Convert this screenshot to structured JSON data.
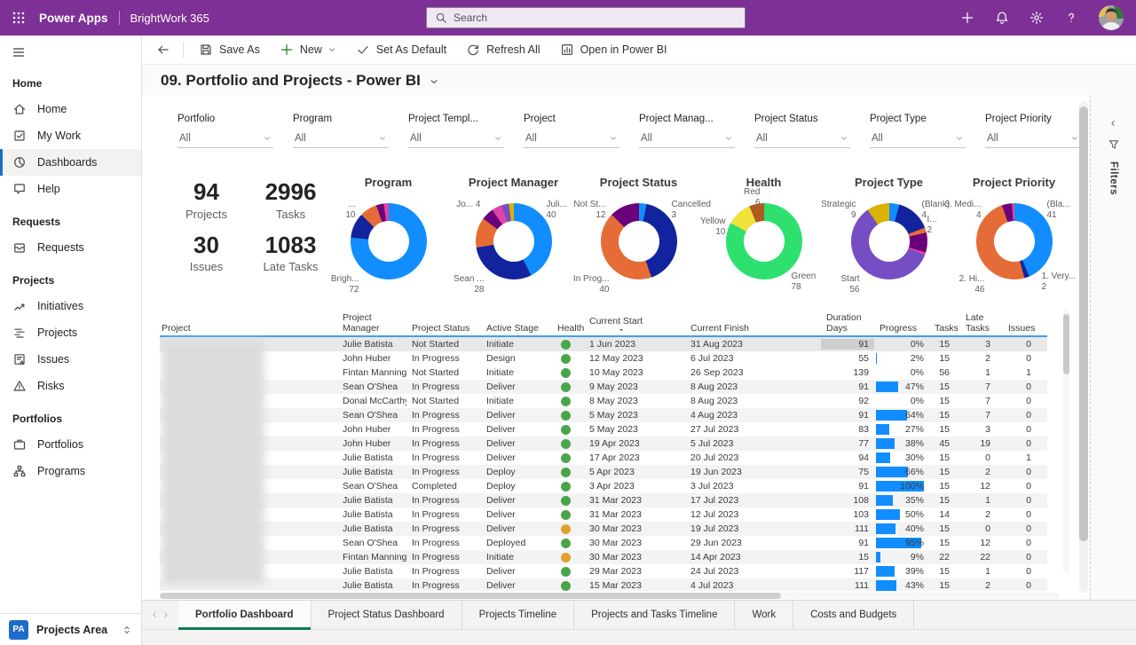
{
  "topbar": {
    "app_name": "Power Apps",
    "environment": "BrightWork 365",
    "search_placeholder": "Search"
  },
  "toolbar": {
    "commands": [
      {
        "label": "Save As",
        "icon": "save-icon"
      },
      {
        "label": "New",
        "icon": "plus-icon",
        "accent": true,
        "chevron": true
      },
      {
        "label": "Set As Default",
        "icon": "check-icon"
      },
      {
        "label": "Refresh All",
        "icon": "refresh-icon"
      },
      {
        "label": "Open in Power BI",
        "icon": "powerbi-icon"
      }
    ]
  },
  "page": {
    "title": "09. Portfolio and Projects - Power BI"
  },
  "sidebar": {
    "sections": [
      {
        "header": "Home",
        "items": [
          {
            "label": "Home",
            "icon": "home-icon",
            "active": false
          },
          {
            "label": "My Work",
            "icon": "my-work-icon",
            "active": false
          },
          {
            "label": "Dashboards",
            "icon": "dashboards-icon",
            "active": true
          },
          {
            "label": "Help",
            "icon": "help-icon",
            "active": false
          }
        ]
      },
      {
        "header": "Requests",
        "items": [
          {
            "label": "Requests",
            "icon": "requests-icon",
            "active": false
          }
        ]
      },
      {
        "header": "Projects",
        "items": [
          {
            "label": "Initiatives",
            "icon": "initiatives-icon",
            "active": false
          },
          {
            "label": "Projects",
            "icon": "projects-icon",
            "active": false
          },
          {
            "label": "Issues",
            "icon": "issues-icon",
            "active": false
          },
          {
            "label": "Risks",
            "icon": "risks-icon",
            "active": false
          }
        ]
      },
      {
        "header": "Portfolios",
        "items": [
          {
            "label": "Portfolios",
            "icon": "portfolios-icon",
            "active": false
          },
          {
            "label": "Programs",
            "icon": "programs-icon",
            "active": false
          }
        ]
      }
    ],
    "footer": {
      "initials": "PA",
      "label": "Projects Area"
    }
  },
  "filter_bar": [
    {
      "label": "Portfolio",
      "value": "All"
    },
    {
      "label": "Program",
      "value": "All"
    },
    {
      "label": "Project Templ...",
      "value": "All"
    },
    {
      "label": "Project",
      "value": "All"
    },
    {
      "label": "Project Manag...",
      "value": "All"
    },
    {
      "label": "Project Status",
      "value": "All"
    },
    {
      "label": "Project Type",
      "value": "All"
    },
    {
      "label": "Project Priority",
      "value": "All"
    }
  ],
  "kpis": [
    {
      "value": "94",
      "label": "Projects"
    },
    {
      "value": "2996",
      "label": "Tasks"
    },
    {
      "value": "30",
      "label": "Issues"
    },
    {
      "value": "1083",
      "label": "Late Tasks"
    }
  ],
  "chart_data": [
    {
      "type": "donut",
      "title": "Program",
      "total": 94,
      "segments": [
        {
          "label": "BrightWork...",
          "value": 72,
          "color": "#118DFF"
        },
        {
          "label": "...",
          "value": 10,
          "color": "#12239E"
        },
        {
          "label": "",
          "value": 7,
          "color": "#E66C37"
        },
        {
          "label": "",
          "value": 3,
          "color": "#6B007B"
        },
        {
          "label": "",
          "value": 2,
          "color": "#E044A7"
        }
      ],
      "callouts": [
        {
          "name": "...",
          "value": "10",
          "pos": "tl"
        },
        {
          "name": "Brigh...",
          "value": "72",
          "pos": "bl"
        }
      ]
    },
    {
      "type": "donut",
      "title": "Project Manager",
      "total": 94,
      "segments": [
        {
          "label": "Juli...",
          "value": 40,
          "color": "#118DFF"
        },
        {
          "label": "Sean ...",
          "value": 28,
          "color": "#12239E"
        },
        {
          "label": "",
          "value": 12,
          "color": "#E66C37"
        },
        {
          "label": "",
          "value": 5,
          "color": "#6B007B"
        },
        {
          "label": "Jo...",
          "value": 4,
          "color": "#E044A7"
        },
        {
          "label": "",
          "value": 3,
          "color": "#744EC2"
        },
        {
          "label": "",
          "value": 2,
          "color": "#D9B300"
        }
      ],
      "callouts": [
        {
          "name": "Jo... 4",
          "value": "",
          "pos": "tl"
        },
        {
          "name": "Juli...",
          "value": "40",
          "pos": "tr"
        },
        {
          "name": "Sean ...",
          "value": "28",
          "pos": "bl"
        }
      ]
    },
    {
      "type": "donut",
      "title": "Project Status",
      "total": 94,
      "segments": [
        {
          "label": "Cancelled",
          "value": 3,
          "color": "#118DFF"
        },
        {
          "label": "",
          "value": 39,
          "color": "#12239E"
        },
        {
          "label": "In Prog...",
          "value": 40,
          "color": "#E66C37"
        },
        {
          "label": "Not St...",
          "value": 12,
          "color": "#6B007B"
        }
      ],
      "callouts": [
        {
          "name": "Not St...",
          "value": "12",
          "pos": "tl"
        },
        {
          "name": "Cancelled",
          "value": "3",
          "pos": "tr"
        },
        {
          "name": "In Prog...",
          "value": "40",
          "pos": "bl"
        }
      ]
    },
    {
      "type": "donut",
      "title": "Health",
      "total": 94,
      "segments": [
        {
          "label": "Green",
          "value": 78,
          "color": "#2EE06E"
        },
        {
          "label": "Yellow",
          "value": 10,
          "color": "#EFE23B"
        },
        {
          "label": "Red",
          "value": 6,
          "color": "#AE5A21"
        }
      ],
      "callouts": [
        {
          "name": "Red",
          "value": "6",
          "pos": "t"
        },
        {
          "name": "Yellow",
          "value": "10",
          "pos": "l"
        },
        {
          "name": "Green",
          "value": "78",
          "pos": "br"
        }
      ]
    },
    {
      "type": "donut",
      "title": "Project Type",
      "total": 94,
      "segments": [
        {
          "label": "(Blank)",
          "value": 4,
          "color": "#118DFF"
        },
        {
          "label": "",
          "value": 14,
          "color": "#12239E"
        },
        {
          "label": "I...",
          "value": 2,
          "color": "#E66C37"
        },
        {
          "label": "",
          "value": 8,
          "color": "#6B007B"
        },
        {
          "label": "",
          "value": 1,
          "color": "#E044A7"
        },
        {
          "label": "Start...",
          "value": 56,
          "color": "#744EC2"
        },
        {
          "label": "Strategic",
          "value": 9,
          "color": "#D9B300"
        }
      ],
      "callouts": [
        {
          "name": "Strategic",
          "value": "9",
          "pos": "tl"
        },
        {
          "name": "(Blank)",
          "value": "4",
          "pos": "tr"
        },
        {
          "name": "I...",
          "value": "2",
          "pos": "r"
        },
        {
          "name": "Start",
          "value": "56",
          "pos": "bl"
        }
      ]
    },
    {
      "type": "donut",
      "title": "Project Priority",
      "total": 94,
      "segments": [
        {
          "label": "(Bla...",
          "value": 41,
          "color": "#118DFF"
        },
        {
          "label": "1. Very...",
          "value": 2,
          "color": "#12239E"
        },
        {
          "label": "2. Hi...",
          "value": 46,
          "color": "#E66C37"
        },
        {
          "label": "3. Medi...",
          "value": 4,
          "color": "#6B007B"
        },
        {
          "label": "",
          "value": 1,
          "color": "#E044A7"
        }
      ],
      "callouts": [
        {
          "name": "3. Medi...",
          "value": "4",
          "pos": "tl"
        },
        {
          "name": "(Bla...",
          "value": "41",
          "pos": "tr"
        },
        {
          "name": "2. Hi...",
          "value": "46",
          "pos": "bl"
        },
        {
          "name": "1. Very...",
          "value": "2",
          "pos": "br"
        }
      ]
    }
  ],
  "table": {
    "columns": [
      {
        "label": "Project"
      },
      {
        "label": "Project Manager"
      },
      {
        "label": "Project Status"
      },
      {
        "label": "Active Stage"
      },
      {
        "label": "Health"
      },
      {
        "label": "Current Start",
        "sorted": true
      },
      {
        "label": "Current Finish"
      },
      {
        "label": "Duration Days"
      },
      {
        "label": "Progress"
      },
      {
        "label": "Tasks"
      },
      {
        "label": "Late Tasks"
      },
      {
        "label": "Issues"
      }
    ],
    "rows": [
      {
        "manager": "Julie Batista",
        "status": "Not Started",
        "stage": "Initiate",
        "health": "green",
        "start": "1 Jun 2023",
        "finish": "31 Aug 2023",
        "duration": 91,
        "progress": 0,
        "tasks": 15,
        "late_tasks": 3,
        "issues": 0,
        "selected": true
      },
      {
        "manager": "John Huber",
        "status": "In Progress",
        "stage": "Design",
        "health": "green",
        "start": "12 May 2023",
        "finish": "6 Jul 2023",
        "duration": 55,
        "progress": 2,
        "tasks": 15,
        "late_tasks": 2,
        "issues": 0
      },
      {
        "manager": "Fintan Manning",
        "status": "Not Started",
        "stage": "Initiate",
        "health": "green",
        "start": "10 May 2023",
        "finish": "26 Sep 2023",
        "duration": 139,
        "progress": 0,
        "tasks": 56,
        "late_tasks": 1,
        "issues": 1
      },
      {
        "manager": "Sean O'Shea",
        "status": "In Progress",
        "stage": "Deliver",
        "health": "green",
        "start": "9 May 2023",
        "finish": "8 Aug 2023",
        "duration": 91,
        "progress": 47,
        "tasks": 15,
        "late_tasks": 7,
        "issues": 0
      },
      {
        "manager": "Donal McCarthy",
        "status": "Not Started",
        "stage": "Initiate",
        "health": "green",
        "start": "8 May 2023",
        "finish": "8 Aug 2023",
        "duration": 92,
        "progress": 0,
        "tasks": 15,
        "late_tasks": 7,
        "issues": 0
      },
      {
        "manager": "Sean O'Shea",
        "status": "In Progress",
        "stage": "Deliver",
        "health": "green",
        "start": "5 May 2023",
        "finish": "4 Aug 2023",
        "duration": 91,
        "progress": 64,
        "tasks": 15,
        "late_tasks": 7,
        "issues": 0
      },
      {
        "manager": "John Huber",
        "status": "In Progress",
        "stage": "Deliver",
        "health": "green",
        "start": "5 May 2023",
        "finish": "27 Jul 2023",
        "duration": 83,
        "progress": 27,
        "tasks": 15,
        "late_tasks": 3,
        "issues": 0
      },
      {
        "manager": "John Huber",
        "status": "In Progress",
        "stage": "Deliver",
        "health": "green",
        "start": "19 Apr 2023",
        "finish": "5 Jul 2023",
        "duration": 77,
        "progress": 38,
        "tasks": 45,
        "late_tasks": 19,
        "issues": 0
      },
      {
        "manager": "Julie Batista",
        "status": "In Progress",
        "stage": "Deliver",
        "health": "green",
        "start": "17 Apr 2023",
        "finish": "20 Jul 2023",
        "duration": 94,
        "progress": 30,
        "tasks": 15,
        "late_tasks": 0,
        "issues": 1
      },
      {
        "manager": "Julie Batista",
        "status": "In Progress",
        "stage": "Deploy",
        "health": "green",
        "start": "5 Apr 2023",
        "finish": "19 Jun 2023",
        "duration": 75,
        "progress": 66,
        "tasks": 15,
        "late_tasks": 2,
        "issues": 0
      },
      {
        "manager": "Sean O'Shea",
        "status": "Completed",
        "stage": "Deploy",
        "health": "green",
        "start": "3 Apr 2023",
        "finish": "3 Jul 2023",
        "duration": 91,
        "progress": 100,
        "tasks": 15,
        "late_tasks": 12,
        "issues": 0
      },
      {
        "manager": "Julie Batista",
        "status": "In Progress",
        "stage": "Deliver",
        "health": "green",
        "start": "31 Mar 2023",
        "finish": "17 Jul 2023",
        "duration": 108,
        "progress": 35,
        "tasks": 15,
        "late_tasks": 1,
        "issues": 0
      },
      {
        "manager": "Julie Batista",
        "status": "In Progress",
        "stage": "Deliver",
        "health": "green",
        "start": "31 Mar 2023",
        "finish": "12 Jul 2023",
        "duration": 103,
        "progress": 50,
        "tasks": 14,
        "late_tasks": 2,
        "issues": 0
      },
      {
        "manager": "Julie Batista",
        "status": "In Progress",
        "stage": "Deliver",
        "health": "yellow",
        "start": "30 Mar 2023",
        "finish": "19 Jul 2023",
        "duration": 111,
        "progress": 40,
        "tasks": 15,
        "late_tasks": 0,
        "issues": 0
      },
      {
        "manager": "Sean O'Shea",
        "status": "In Progress",
        "stage": "Deployed",
        "health": "green",
        "start": "30 Mar 2023",
        "finish": "29 Jun 2023",
        "duration": 91,
        "progress": 95,
        "tasks": 15,
        "late_tasks": 12,
        "issues": 0
      },
      {
        "manager": "Fintan Manning",
        "status": "In Progress",
        "stage": "Initiate",
        "health": "yellow",
        "start": "30 Mar 2023",
        "finish": "14 Apr 2023",
        "duration": 15,
        "progress": 9,
        "tasks": 22,
        "late_tasks": 22,
        "issues": 0
      },
      {
        "manager": "Julie Batista",
        "status": "In Progress",
        "stage": "Deliver",
        "health": "green",
        "start": "29 Mar 2023",
        "finish": "24 Jul 2023",
        "duration": 117,
        "progress": 39,
        "tasks": 15,
        "late_tasks": 1,
        "issues": 0
      },
      {
        "manager": "Julie Batista",
        "status": "In Progress",
        "stage": "Deliver",
        "health": "green",
        "start": "15 Mar 2023",
        "finish": "4 Jul 2023",
        "duration": 111,
        "progress": 43,
        "tasks": 15,
        "late_tasks": 2,
        "issues": 0
      }
    ]
  },
  "bottom_tabs": {
    "tabs": [
      "Portfolio Dashboard",
      "Project Status Dashboard",
      "Projects Timeline",
      "Projects and Tasks Timeline",
      "Work",
      "Costs and Budgets"
    ],
    "active_index": 0
  },
  "filters_panel": {
    "label": "Filters"
  },
  "colors": {
    "header_purple": "#7d3095",
    "active_tab_underline": "#0e7a5a",
    "progress_bar": "#118DFF",
    "selected_nav_accent": "#1b6fc5",
    "health_green_dot": "#4aa54a",
    "health_yellow_dot": "#e0a030",
    "table_header_rule": "#3aa0f3"
  }
}
